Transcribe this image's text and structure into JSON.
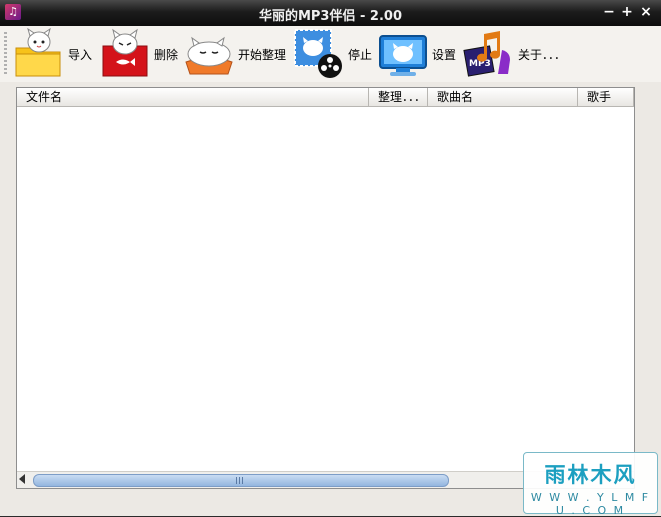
{
  "window": {
    "title": "华丽的MP3伴侣 - 2.00",
    "minimize": "−",
    "maximize": "+",
    "close": "×"
  },
  "toolbar": {
    "items": [
      {
        "label": "导入",
        "icon": "folder-cat-icon"
      },
      {
        "label": "删除",
        "icon": "delete-box-cat-icon"
      },
      {
        "label": "开始整理",
        "icon": "sleeping-cat-icon"
      },
      {
        "label": "停止",
        "icon": "stamp-film-icon"
      },
      {
        "label": "设置",
        "icon": "monitor-cat-icon"
      },
      {
        "label": "关于．．．",
        "icon": "mp3-music-icon"
      }
    ]
  },
  "list": {
    "columns": [
      "文件名",
      "整理．．．",
      "歌曲名",
      "歌手"
    ],
    "rows": []
  },
  "scrollbar": {
    "grip": "III"
  },
  "watermark": {
    "top": "雨林木风",
    "bottom": "W W W . Y L M F U . C O M"
  },
  "colors": {
    "titlebar": "#1c1c1c",
    "window_bg": "#ece9e4",
    "scroll_thumb": "#94b6df",
    "watermark": "#1c9fc0"
  }
}
